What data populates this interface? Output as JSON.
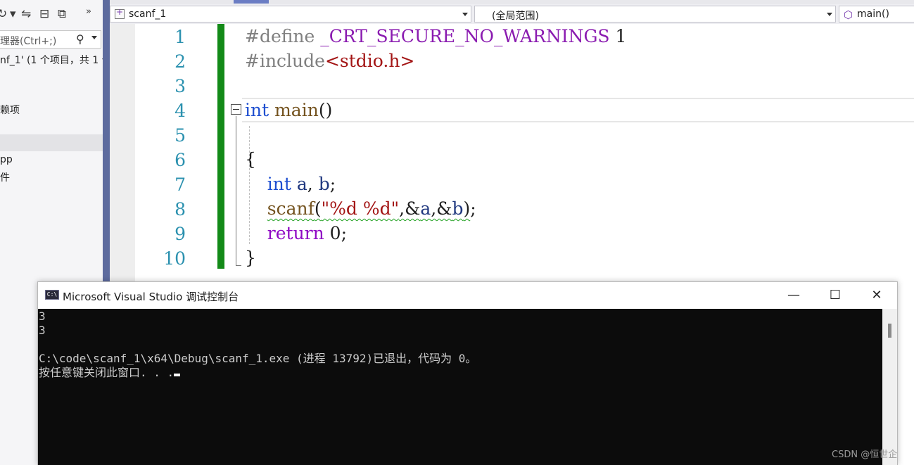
{
  "solution_explorer": {
    "search_placeholder": "理器(Ctrl+;)",
    "solution_label": "nf_1' (1 个项目，共 1 个",
    "tree_item_3": "赖项",
    "tree_item_5": "pp",
    "tree_item_6": "件",
    "toolbar_arrow": "»"
  },
  "navigation_bar": {
    "project": "scanf_1",
    "scope": "(全局范围)",
    "function": "main()"
  },
  "editor": {
    "line_numbers": [
      "1",
      "2",
      "3",
      "4",
      "5",
      "6",
      "7",
      "8",
      "9",
      "10"
    ],
    "lines": {
      "l1_directive": "#define",
      "l1_macro": "_CRT_SECURE_NO_WARNINGS",
      "l1_value": " 1",
      "l2_directive": "#include",
      "l2_header": "<stdio.h>",
      "l4_type": "int",
      "l4_name": " main",
      "l4_parens": "()",
      "l6": "{",
      "l7_type": "    int",
      "l7_a": " a",
      "l7_comma": ", ",
      "l7_b": "b",
      "l7_semi": ";",
      "l8_indent": "    ",
      "l8_fn": "scanf",
      "l8_open": "(",
      "l8_str": "\"%d %d\"",
      "l8_amp_a": ",&",
      "l8_a": "a",
      "l8_amp_b": ",&",
      "l8_b": "b",
      "l8_close": ")",
      "l8_semi": ";",
      "l9_kw": "    return",
      "l9_val": " 0;",
      "l10": "}"
    }
  },
  "console": {
    "title": "Microsoft Visual Studio 调试控制台",
    "app_icon_text": "C:\\",
    "minimize": "—",
    "maximize": "☐",
    "close": "✕",
    "output": [
      "3",
      "3",
      "",
      "C:\\code\\scanf_1\\x64\\Debug\\scanf_1.exe (进程 13792)已退出，代码为 0。",
      "按任意键关闭此窗口. . ."
    ]
  },
  "watermark": "CSDN @恒世企",
  "colors": {
    "change_bar": "#138a18",
    "console_bg": "#0c0c0c",
    "line_number": "#2b91af",
    "keyword": "#1f4fd0",
    "string": "#a31515",
    "macro": "#8a1bb0",
    "vs_frame": "#5d6b9e"
  }
}
